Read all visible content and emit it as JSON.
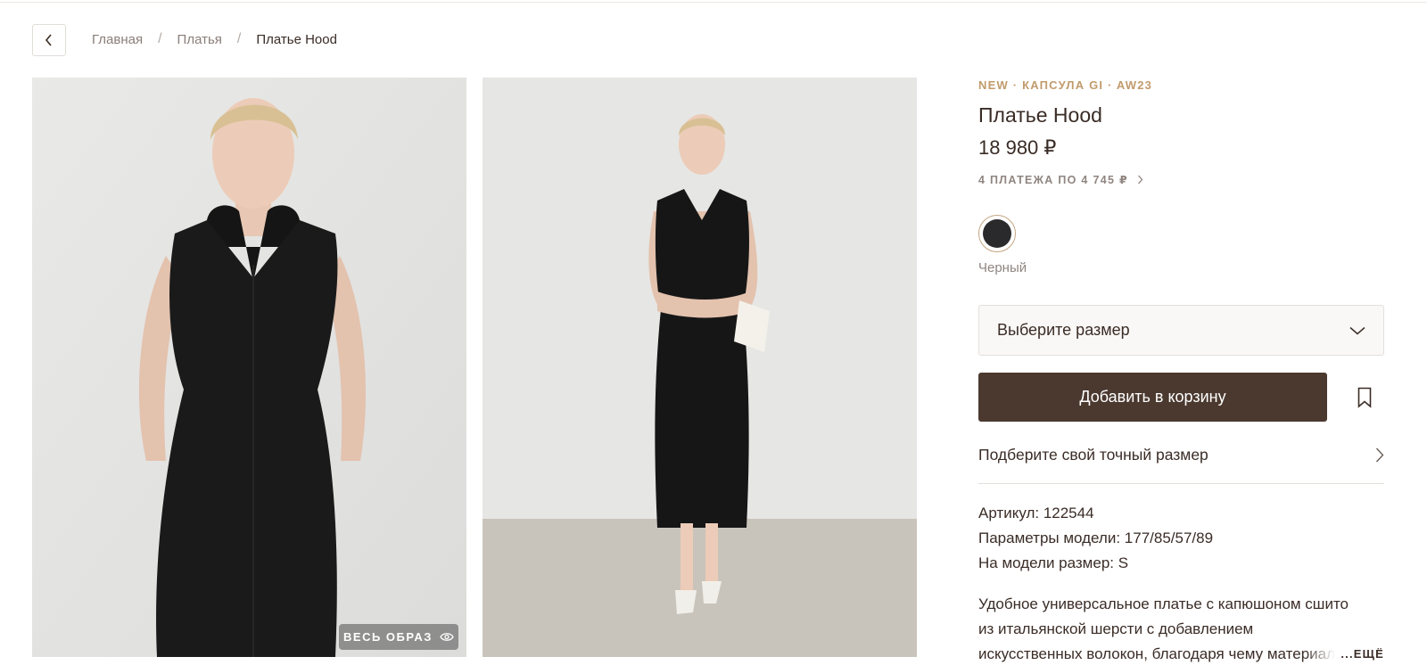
{
  "breadcrumb": {
    "items": [
      {
        "label": "Главная"
      },
      {
        "label": "Платья"
      },
      {
        "label": "Платье Hood"
      }
    ],
    "separator": "/"
  },
  "gallery": {
    "look_badge": "ВЕСЬ ОБРАЗ"
  },
  "product": {
    "tagline": "NEW · КАПСУЛА GI · AW23",
    "title": "Платье Hood",
    "price": "18 980 ₽",
    "installments": "4 ПЛАТЕЖА ПО 4 745 ₽",
    "color": {
      "name": "Черный",
      "hex": "#2a2a2c"
    },
    "size_select": {
      "placeholder": "Выберите размер"
    },
    "add_to_cart": "Добавить в корзину",
    "fit_link": "Подберите свой точный размер",
    "specs": {
      "article": "Артикул: 122544",
      "model_params": "Параметры модели: 177/85/57/89",
      "model_size": "На модели размер: S"
    },
    "description": "Удобное универсальное платье с капюшоном сшито из итальянской шерсти с добавлением искусственных волокон, благодаря чему материал",
    "more": "...ЕЩЁ"
  },
  "colors": {
    "accent": "#c19b6c",
    "primary_button": "#4b392f",
    "text": "#3a2c26",
    "muted": "#8f8580"
  }
}
